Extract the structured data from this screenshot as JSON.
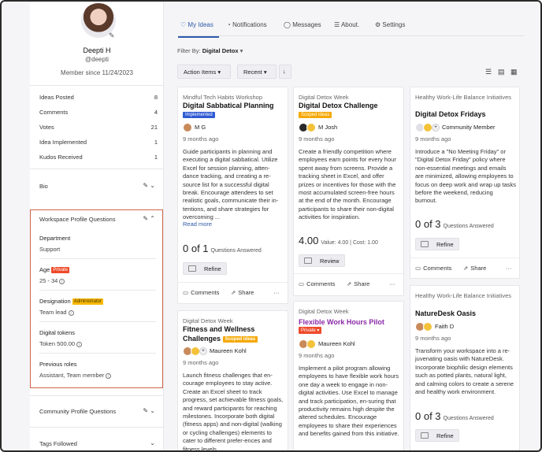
{
  "profile": {
    "name": "Deepti H",
    "handle": "@deepti",
    "member_since": "Member since 11/24/2023"
  },
  "stats": [
    {
      "label": "Ideas Posted",
      "value": "8"
    },
    {
      "label": "Comments",
      "value": "4"
    },
    {
      "label": "Votes",
      "value": "21"
    },
    {
      "label": "Idea Implemented",
      "value": "1"
    },
    {
      "label": "Kudos Received",
      "value": "1"
    }
  ],
  "bio": {
    "title": "Bio"
  },
  "workspace": {
    "title": "Workspace Profile Questions",
    "fields": [
      {
        "label": "Department",
        "value": "Support",
        "tag": ""
      },
      {
        "label": "Age",
        "value": "25 - 34",
        "tag": "Private"
      },
      {
        "label": "Designation",
        "value": "Team lead",
        "tag": "Administrator"
      },
      {
        "label": "Digital tokens",
        "value": "Token 500.00",
        "tag": ""
      },
      {
        "label": "Previous roles",
        "value": "Assistant, Team member",
        "tag": ""
      }
    ]
  },
  "community": {
    "title": "Community Profile Questions"
  },
  "tags_followed": {
    "title": "Tags Followed"
  },
  "tabs": [
    {
      "label": "My Ideas",
      "icon": "lightbulb-icon"
    },
    {
      "label": "Notifications",
      "icon": "bell-icon"
    },
    {
      "label": "Messages",
      "icon": "chat-icon"
    },
    {
      "label": "About.",
      "icon": "list-icon"
    },
    {
      "label": "Settings",
      "icon": "gear-icon"
    }
  ],
  "filter": {
    "label": "Filter By:",
    "value": "Digital Detox"
  },
  "toolbar": {
    "actions": "Action Items",
    "sort": "Recent"
  },
  "cards": [
    {
      "category": "Mindful Tech Habits Workshop",
      "title": "Digital Sabbatical Planning",
      "tag": "Implemented",
      "author": "M G",
      "time": "9 months ago",
      "desc": "Guide participants in planning and executing a digital sabbatical. Utilize Excel for session planning, atten-dance tracking, and creating a re-source list for a successful digital break. Encourage attendees to set realistic goals, communicate their in-tentions, and share strategies for overcoming ...",
      "more": "Read more",
      "q_of": "0 of 1",
      "q_label": "Questions Answered",
      "button": "Refine",
      "comments": "Comments",
      "share": "Share"
    },
    {
      "category": "Digital Detox Week",
      "title": "Digital Detox Challenge",
      "tag": "Scoped ideas",
      "author": "M Josh",
      "time": "9 months ago",
      "desc": "Create a friendly competition where employees earn points for every hour spent away from screens. Provide a tracking sheet in Excel, and offer prizes or incentives for those with the most accumulated screen-free hours at the end of the month. Encourage participants to share their non-digital activities for inspiration.",
      "value": "4.00",
      "value_detail": "Value: 4.00",
      "cost_detail": "Cost: 1.00",
      "button": "Review",
      "comments": "Comments",
      "share": "Share"
    },
    {
      "category": "Healthy Work-Life Balance Initiatives",
      "title": "Digital Detox Fridays",
      "author": "Community Member",
      "time": "9 months ago",
      "desc": "Introduce a \"No Meeting Friday\" or \"Digital Detox Friday\" policy where non-essential meetings and emails are minimized, allowing employees to focus on deep work and wrap up tasks before the weekend, reducing burnout.",
      "q_of": "0 of 3",
      "q_label": "Questions Answered",
      "button": "Refine",
      "comments": "Comments",
      "share": "Share"
    },
    {
      "category": "Digital Detox Week",
      "title": "Fitness and Wellness Challenges",
      "tag": "Scoped ideas",
      "author": "Maureen Kohl",
      "time": "9 months ago",
      "desc": "Launch fitness challenges that en-courage employees to stay active. Create an Excel sheet to track progress, set achievable fitness goals, and reward participants for reaching milestones. Incorporate both digital (fitness apps) and non-digital (walking or cycling challenges) elements to cater to different prefer-ences and fitness levels."
    },
    {
      "category": "Digital Detox Week",
      "title": "Flexible Work Hours Pilot",
      "tag": "Private",
      "author": "Maureen Kohl",
      "time": "9 months ago",
      "desc": "Implement a pilot program allowing employees to have flexible work hours one day a week to engage in non-digital activities. Use Excel to manage and track participation, en-suring that productivity remains high despite the altered schedules. Encourage employees to share their experiences and benefits gained from this initiative."
    },
    {
      "category": "Healthy Work-Life Balance Initiatives",
      "title": "NatureDesk Oasis",
      "author": "Faith D",
      "time": "9 months ago",
      "desc": "Transform your workspace into a re-juvenating oasis with NatureDesk. Incorporate biophilic design elements such as potted plants, natural light, and calming colors to create a serene and healthy work environment.",
      "q_of": "0 of 3",
      "q_label": "Questions Answered",
      "button": "Refine"
    }
  ]
}
